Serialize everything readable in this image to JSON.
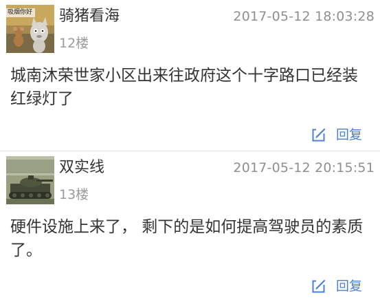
{
  "posts": [
    {
      "username": "骑猪看海",
      "timestamp": "2017-05-12 18:03:28",
      "floor": "12楼",
      "content": "城南沐荣世家小区出来往政府这个十字路口已经装红绿灯了",
      "avatar_icon": "cartoon-cat-mouse-avatar",
      "avatar_text": "吸烟你好",
      "reply_label": "回复"
    },
    {
      "username": "双实线",
      "timestamp": "2017-05-12 20:15:51",
      "floor": "13楼",
      "content": "硬件设施上来了， 剩下的是如何提高驾驶员的素质了。",
      "avatar_icon": "tank-avatar",
      "reply_label": "回复"
    }
  ],
  "colors": {
    "accent": "#4a7fd1",
    "text": "#333333",
    "muted": "#9a9a9a",
    "divider": "#e3e3e3"
  }
}
